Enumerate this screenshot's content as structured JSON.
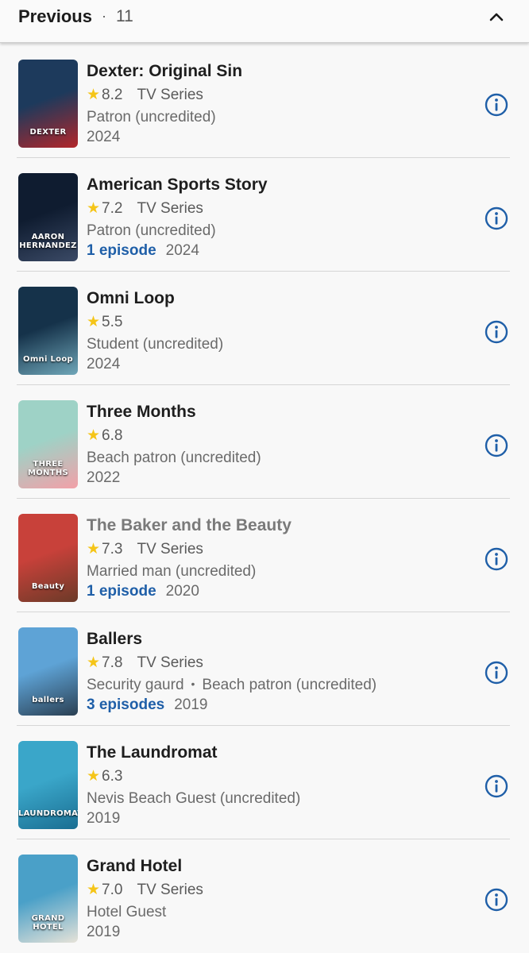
{
  "header": {
    "title": "Previous",
    "separator": "·",
    "count": "11"
  },
  "items": [
    {
      "title": "Dexter: Original Sin",
      "rating": "8.2",
      "type": "TV Series",
      "roles": [
        "Patron (uncredited)"
      ],
      "episodes": "",
      "year": "2024",
      "poster_label": "DEXTER",
      "poster_colors": [
        "#1d3a5c",
        "#b3262a"
      ],
      "muted": false
    },
    {
      "title": "American Sports Story",
      "rating": "7.2",
      "type": "TV Series",
      "roles": [
        "Patron (uncredited)"
      ],
      "episodes": "1 episode",
      "year": "2024",
      "poster_label": "AARON HERNANDEZ",
      "poster_colors": [
        "#0f1c30",
        "#3b4a66"
      ],
      "muted": false
    },
    {
      "title": "Omni Loop",
      "rating": "5.5",
      "type": "",
      "roles": [
        "Student (uncredited)"
      ],
      "episodes": "",
      "year": "2024",
      "poster_label": "Omni Loop",
      "poster_colors": [
        "#15324a",
        "#6fa6b8"
      ],
      "muted": false
    },
    {
      "title": "Three Months",
      "rating": "6.8",
      "type": "",
      "roles": [
        "Beach patron (uncredited)"
      ],
      "episodes": "",
      "year": "2022",
      "poster_label": "THREE MONTHS",
      "poster_colors": [
        "#9ed2c6",
        "#f2a0a8"
      ],
      "muted": false
    },
    {
      "title": "The Baker and the Beauty",
      "rating": "7.3",
      "type": "TV Series",
      "roles": [
        "Married man (uncredited)"
      ],
      "episodes": "1 episode",
      "year": "2020",
      "poster_label": "Beauty",
      "poster_colors": [
        "#c8413a",
        "#6b3a28"
      ],
      "muted": true
    },
    {
      "title": "Ballers",
      "rating": "7.8",
      "type": "TV Series",
      "roles": [
        "Security gaurd",
        "Beach patron (uncredited)"
      ],
      "episodes": "3 episodes",
      "year": "2019",
      "poster_label": "ballers",
      "poster_colors": [
        "#5ea3d6",
        "#2a3f52"
      ],
      "muted": false
    },
    {
      "title": "The Laundromat",
      "rating": "6.3",
      "type": "",
      "roles": [
        "Nevis Beach Guest (uncredited)"
      ],
      "episodes": "",
      "year": "2019",
      "poster_label": "LAUNDROMAT",
      "poster_colors": [
        "#3aa6c9",
        "#1a6e92"
      ],
      "muted": false
    },
    {
      "title": "Grand Hotel",
      "rating": "7.0",
      "type": "TV Series",
      "roles": [
        "Hotel Guest"
      ],
      "episodes": "",
      "year": "2019",
      "poster_label": "GRAND HOTEL",
      "poster_colors": [
        "#4aa0c8",
        "#e6e2d8"
      ],
      "muted": false
    }
  ],
  "colors": {
    "accent": "#1f5fa8",
    "star": "#f5c518",
    "background": "#f8f8f8"
  },
  "icons": {
    "collapse": "chevron-up-icon",
    "info": "info-icon",
    "star": "star-icon"
  }
}
